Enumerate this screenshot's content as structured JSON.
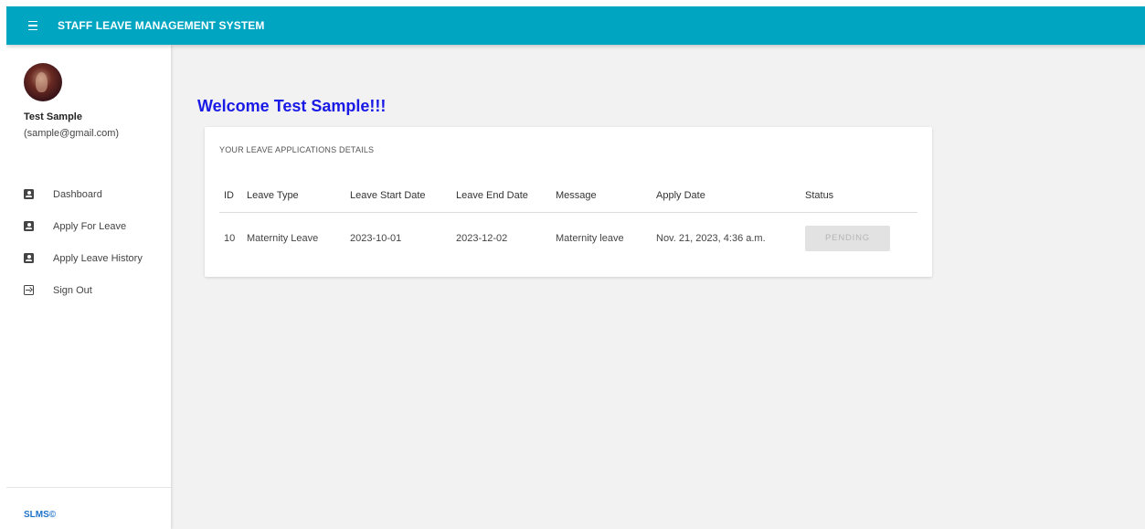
{
  "app": {
    "title": "STAFF LEAVE MANAGEMENT SYSTEM",
    "accent_color": "#00a6c1",
    "menu_icon": "hamburger-menu-icon"
  },
  "sidebar": {
    "user": {
      "name": "Test Sample",
      "email": "(sample@gmail.com)"
    },
    "items": [
      {
        "label": "Dashboard",
        "icon": "account-box-icon"
      },
      {
        "label": "Apply For Leave",
        "icon": "account-box-icon"
      },
      {
        "label": "Apply Leave History",
        "icon": "account-box-icon"
      },
      {
        "label": "Sign Out",
        "icon": "exit-to-app-icon"
      }
    ],
    "footer": "SLMS©"
  },
  "main": {
    "welcome": "Welcome Test Sample!!!",
    "card_title": "YOUR LEAVE APPLICATIONS DETAILS",
    "table": {
      "headers": [
        "ID",
        "Leave Type",
        "Leave Start Date",
        "Leave End Date",
        "Message",
        "Apply Date",
        "Status"
      ],
      "rows": [
        {
          "id": "10",
          "leave_type": "Maternity Leave",
          "start_date": "2023-10-01",
          "end_date": "2023-12-02",
          "message": "Maternity leave",
          "apply_date": "Nov. 21, 2023, 4:36 a.m.",
          "status": "PENDING"
        }
      ]
    }
  }
}
